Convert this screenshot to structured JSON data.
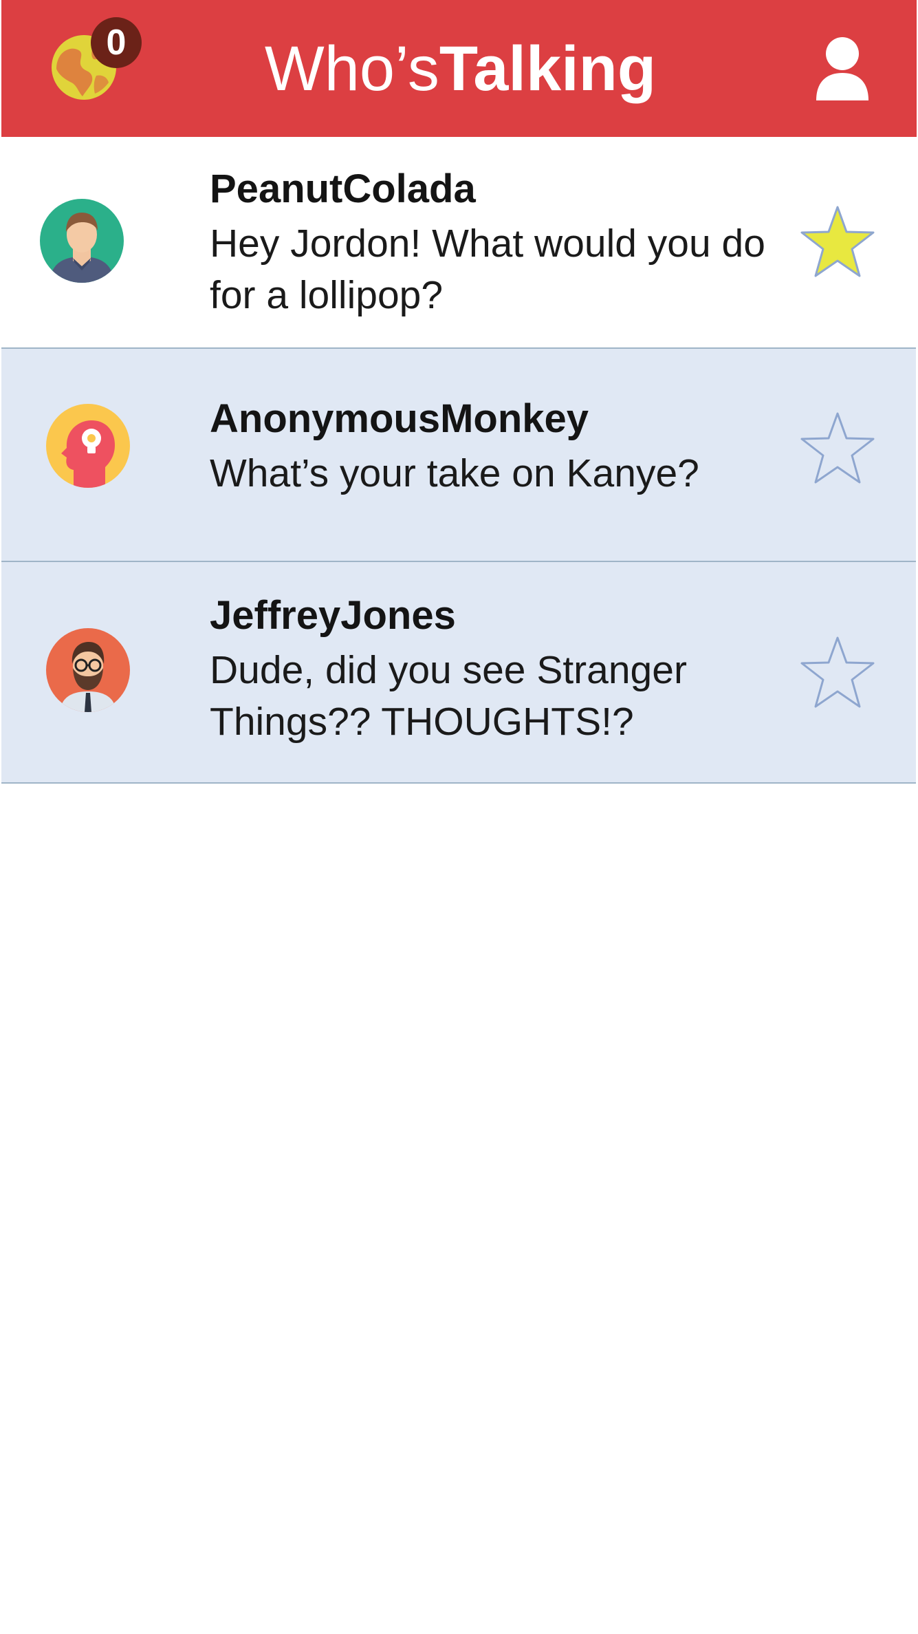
{
  "header": {
    "title_light": "Who’s",
    "title_bold": "Talking",
    "notification_count": "0",
    "left_icon": "globe-icon",
    "right_icon": "user-profile-icon"
  },
  "colors": {
    "header_bg": "#dc3f42",
    "badge_bg": "#6b2218",
    "globe_land": "#e0d43a",
    "unread_row_bg": "#e0e8f4",
    "star_filled": "#e8e840",
    "star_outline": "#8ea6cf"
  },
  "conversations": [
    {
      "sender": "PeanutColada",
      "preview": "Hey Jordon! What would you do for a lollipop?",
      "avatar": "man-teal-avatar-icon",
      "starred": true
    },
    {
      "sender": "AnonymousMonkey",
      "preview": "What’s your take on Kanye?",
      "avatar": "lightbulb-head-avatar-icon",
      "starred": false
    },
    {
      "sender": "JeffreyJones",
      "preview": "Dude,  did you see Stranger Things?? THOUGHTS!?",
      "avatar": "bearded-man-avatar-icon",
      "starred": false
    }
  ]
}
